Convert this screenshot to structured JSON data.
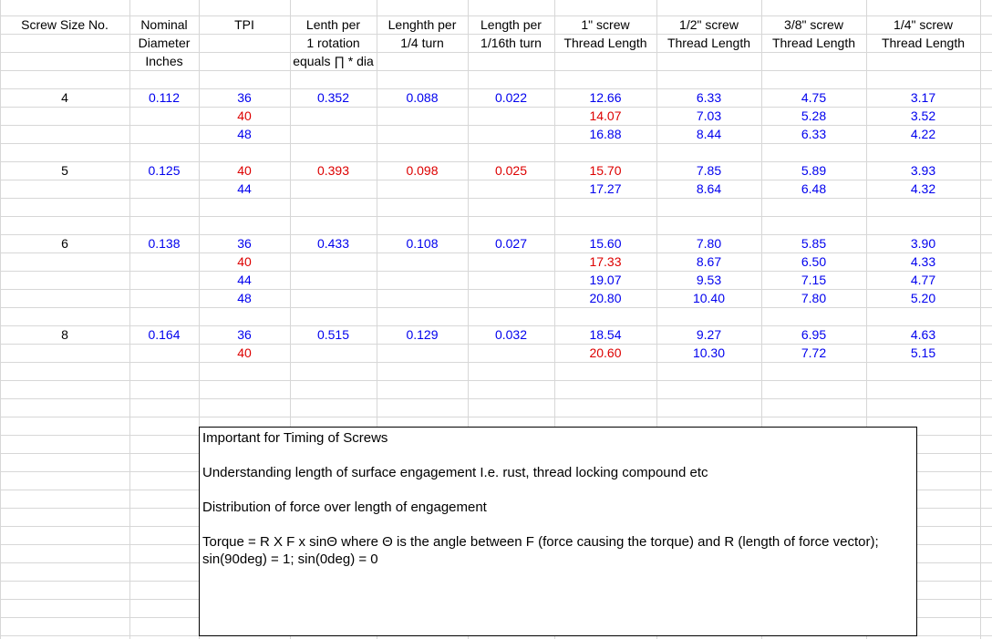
{
  "headers": [
    [
      "Screw Size No.",
      "",
      ""
    ],
    [
      "Nominal",
      "Diameter",
      "Inches"
    ],
    [
      "TPI",
      "",
      ""
    ],
    [
      "Lenth per",
      "1 rotation",
      "equals ∏ * dia"
    ],
    [
      "Lenghth per",
      "1/4 turn",
      ""
    ],
    [
      "Length per",
      "1/16th turn",
      ""
    ],
    [
      "1\" screw",
      "Thread Length",
      ""
    ],
    [
      "1/2\" screw",
      "Thread Length",
      ""
    ],
    [
      "3/8\" screw",
      "Thread Length",
      ""
    ],
    [
      "1/4\" screw",
      "Thread Length",
      ""
    ]
  ],
  "rows": [
    {
      "size": "4",
      "dia": "0.112",
      "tpi": "36",
      "rot": "0.352",
      "q": "0.088",
      "s": "0.022",
      "t1": "12.66",
      "t2": "6.33",
      "t3": "4.75",
      "t4": "3.17",
      "color": "blue"
    },
    {
      "size": "",
      "dia": "",
      "tpi": "40",
      "rot": "",
      "q": "",
      "s": "",
      "t1": "14.07",
      "t2": "7.03",
      "t3": "5.28",
      "t4": "3.52",
      "color": "red"
    },
    {
      "size": "",
      "dia": "",
      "tpi": "48",
      "rot": "",
      "q": "",
      "s": "",
      "t1": "16.88",
      "t2": "8.44",
      "t3": "6.33",
      "t4": "4.22",
      "color": "blue"
    },
    {
      "size": "5",
      "dia": "0.125",
      "tpi": "40",
      "rot": "0.393",
      "q": "0.098",
      "s": "0.025",
      "t1": "15.70",
      "t2": "7.85",
      "t3": "5.89",
      "t4": "3.93",
      "color": "red"
    },
    {
      "size": "",
      "dia": "",
      "tpi": "44",
      "rot": "",
      "q": "",
      "s": "",
      "t1": "17.27",
      "t2": "8.64",
      "t3": "6.48",
      "t4": "4.32",
      "color": "blue"
    },
    {
      "size": "6",
      "dia": "0.138",
      "tpi": "36",
      "rot": "0.433",
      "q": "0.108",
      "s": "0.027",
      "t1": "15.60",
      "t2": "7.80",
      "t3": "5.85",
      "t4": "3.90",
      "color": "blue"
    },
    {
      "size": "",
      "dia": "",
      "tpi": "40",
      "rot": "",
      "q": "",
      "s": "",
      "t1": "17.33",
      "t2": "8.67",
      "t3": "6.50",
      "t4": "4.33",
      "color": "red"
    },
    {
      "size": "",
      "dia": "",
      "tpi": "44",
      "rot": "",
      "q": "",
      "s": "",
      "t1": "19.07",
      "t2": "9.53",
      "t3": "7.15",
      "t4": "4.77",
      "color": "blue"
    },
    {
      "size": "",
      "dia": "",
      "tpi": "48",
      "rot": "",
      "q": "",
      "s": "",
      "t1": "20.80",
      "t2": "10.40",
      "t3": "7.80",
      "t4": "5.20",
      "color": "blue"
    },
    {
      "size": "8",
      "dia": "0.164",
      "tpi": "36",
      "rot": "0.515",
      "q": "0.129",
      "s": "0.032",
      "t1": "18.54",
      "t2": "9.27",
      "t3": "6.95",
      "t4": "4.63",
      "color": "blue"
    },
    {
      "size": "",
      "dia": "",
      "tpi": "40",
      "rot": "",
      "q": "",
      "s": "",
      "t1": "20.60",
      "t2": "10.30",
      "t3": "7.72",
      "t4": "5.15",
      "color": "red"
    }
  ],
  "note": {
    "title": "Important for Timing of Screws",
    "line2": "Understanding length of surface engagement I.e. rust, thread locking compound etc",
    "line3": "Distribution of force over length of engagement",
    "line4": "Torque = R X F x sinΘ  where Θ is the angle between F (force causing the torque) and R (length of force vector); sin(90deg) = 1; sin(0deg) = 0"
  },
  "colors": {
    "blue": "#0000ee",
    "red": "#dd0000",
    "grid": "#d7d7d7"
  }
}
